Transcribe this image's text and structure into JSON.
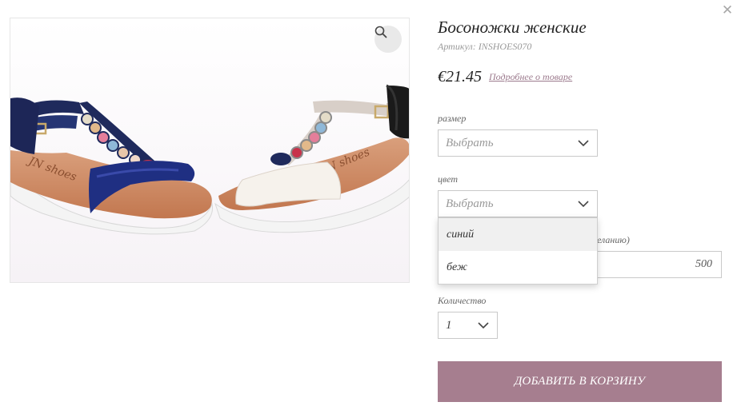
{
  "product": {
    "title": "Босоножки женские",
    "sku_label": "Артикул:",
    "sku_value": "INSHOES070",
    "price": "€21.45",
    "details_link": "Подробнее о товаре"
  },
  "image": {
    "brand_mark_left": "JN shoes",
    "brand_mark_right": "JN shoes"
  },
  "fields": {
    "size": {
      "label": "размер",
      "value": "Выбрать"
    },
    "color": {
      "label": "цвет",
      "value": "Выбрать",
      "options": [
        "синий",
        "беж"
      ],
      "hovered_option": "синий"
    },
    "custom": {
      "label_visible_part": "желанию)",
      "value": "500"
    },
    "quantity": {
      "label": "Количество",
      "value": "1"
    }
  },
  "actions": {
    "add_to_cart": "ДОБАВИТЬ В КОРЗИНУ"
  },
  "icons": {
    "close": "close-icon",
    "zoom": "magnifier-icon",
    "chevron": "chevron-down-icon"
  },
  "colors": {
    "accent": "#a67e8f",
    "link": "#9c7a8d",
    "border": "#c9c9c9"
  }
}
